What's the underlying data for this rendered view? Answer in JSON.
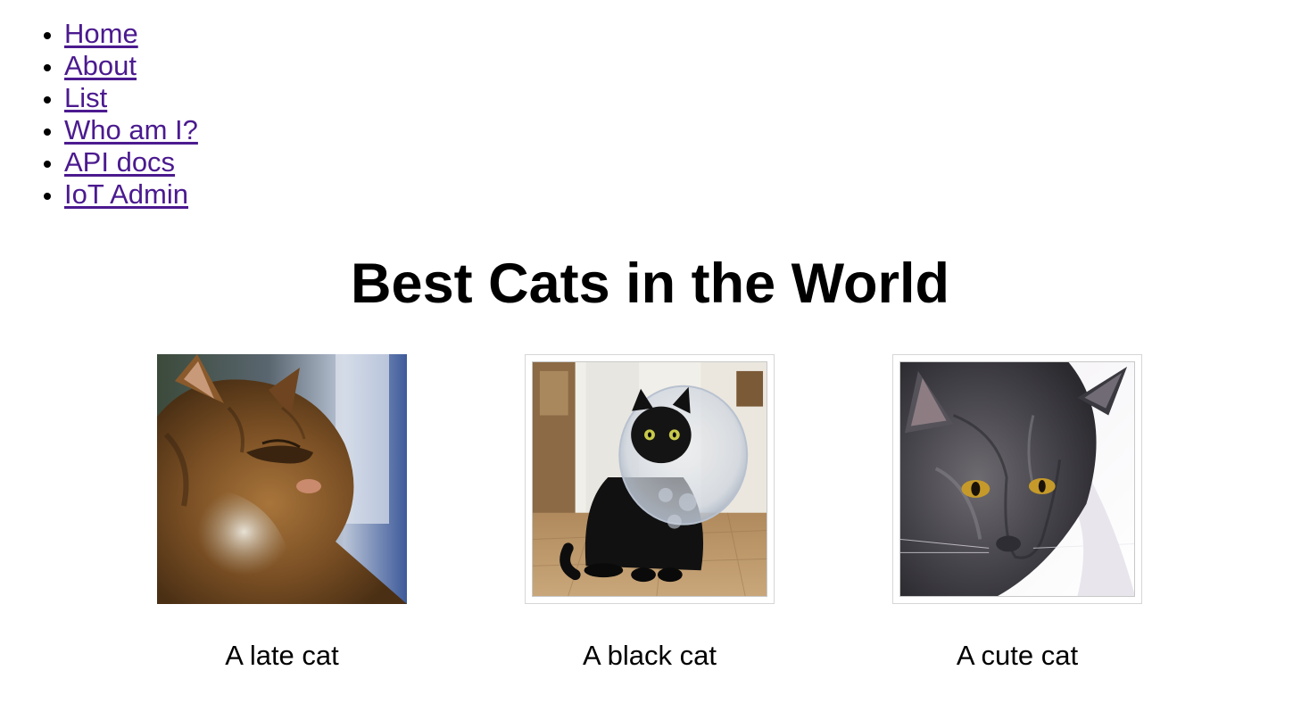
{
  "nav": {
    "items": [
      {
        "label": "Home"
      },
      {
        "label": "About"
      },
      {
        "label": "List"
      },
      {
        "label": "Who am I?"
      },
      {
        "label": "API docs"
      },
      {
        "label": "IoT Admin"
      }
    ]
  },
  "page": {
    "title": "Best Cats in the World"
  },
  "gallery": {
    "cards": [
      {
        "caption": "A late cat",
        "icon": "tabby-cat-photo"
      },
      {
        "caption": "A black cat",
        "icon": "black-cat-cone-photo"
      },
      {
        "caption": "A cute cat",
        "icon": "gray-cat-photo"
      }
    ]
  },
  "colors": {
    "link": "#4b1a8f",
    "text": "#000000",
    "background": "#ffffff"
  }
}
